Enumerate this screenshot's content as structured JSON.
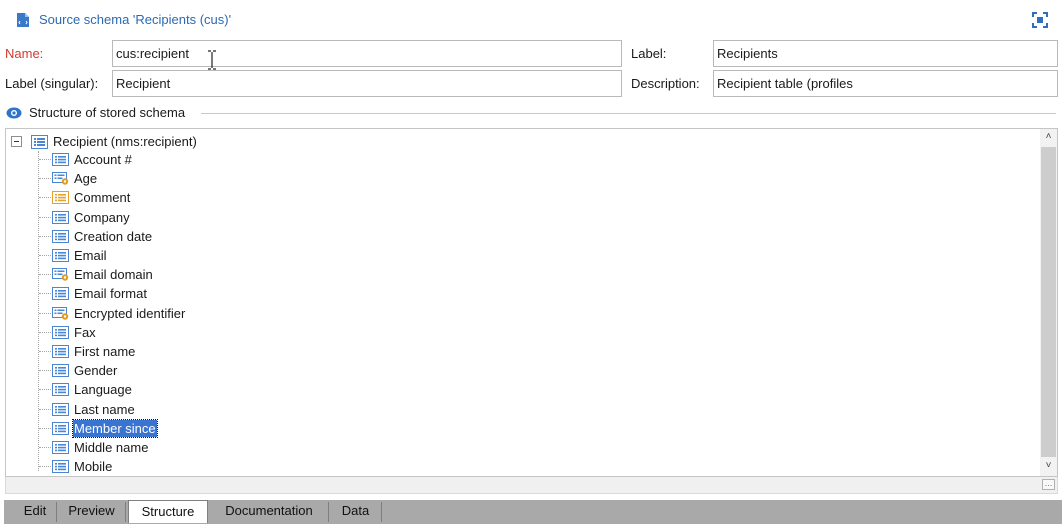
{
  "header": {
    "title": "Source schema 'Recipients (cus)'",
    "icons": {
      "schema": "schema-file-icon",
      "fit": "fit-to-screen-icon"
    }
  },
  "form": {
    "name_label": "Name:",
    "name_value": "cus:recipient",
    "label_label": "Label:",
    "label_value": "Recipients",
    "label_singular_label": "Label (singular):",
    "label_singular_value": "Recipient",
    "description_label": "Description:",
    "description_value": "Recipient table (profiles"
  },
  "section": {
    "title": "Structure of stored schema",
    "icon": "eye-icon"
  },
  "tree": {
    "root_label": "Recipient (nms:recipient)",
    "items": [
      {
        "label": "Account #",
        "icon": "attribute-icon"
      },
      {
        "label": "Age",
        "icon": "calculated-attribute-icon"
      },
      {
        "label": "Comment",
        "icon": "memo-attribute-icon"
      },
      {
        "label": "Company",
        "icon": "attribute-icon"
      },
      {
        "label": "Creation date",
        "icon": "attribute-icon"
      },
      {
        "label": "Email",
        "icon": "attribute-icon"
      },
      {
        "label": "Email domain",
        "icon": "calculated-attribute-icon"
      },
      {
        "label": "Email format",
        "icon": "attribute-icon"
      },
      {
        "label": "Encrypted identifier",
        "icon": "calculated-attribute-icon"
      },
      {
        "label": "Fax",
        "icon": "attribute-icon"
      },
      {
        "label": "First name",
        "icon": "attribute-icon"
      },
      {
        "label": "Gender",
        "icon": "attribute-icon"
      },
      {
        "label": "Language",
        "icon": "attribute-icon"
      },
      {
        "label": "Last name",
        "icon": "attribute-icon"
      },
      {
        "label": "Member since",
        "icon": "attribute-icon",
        "selected": true
      },
      {
        "label": "Middle name",
        "icon": "attribute-icon"
      },
      {
        "label": "Mobile",
        "icon": "attribute-icon"
      }
    ]
  },
  "tabs": [
    {
      "label": "Edit"
    },
    {
      "label": "Preview"
    },
    {
      "label": "Structure",
      "active": true
    },
    {
      "label": "Documentation"
    },
    {
      "label": "Data"
    }
  ],
  "colors": {
    "title": "#2a6ab3",
    "required_label": "#d43a2f",
    "selection": "#3a74d1",
    "tab_bar": "#a9a9a9"
  }
}
